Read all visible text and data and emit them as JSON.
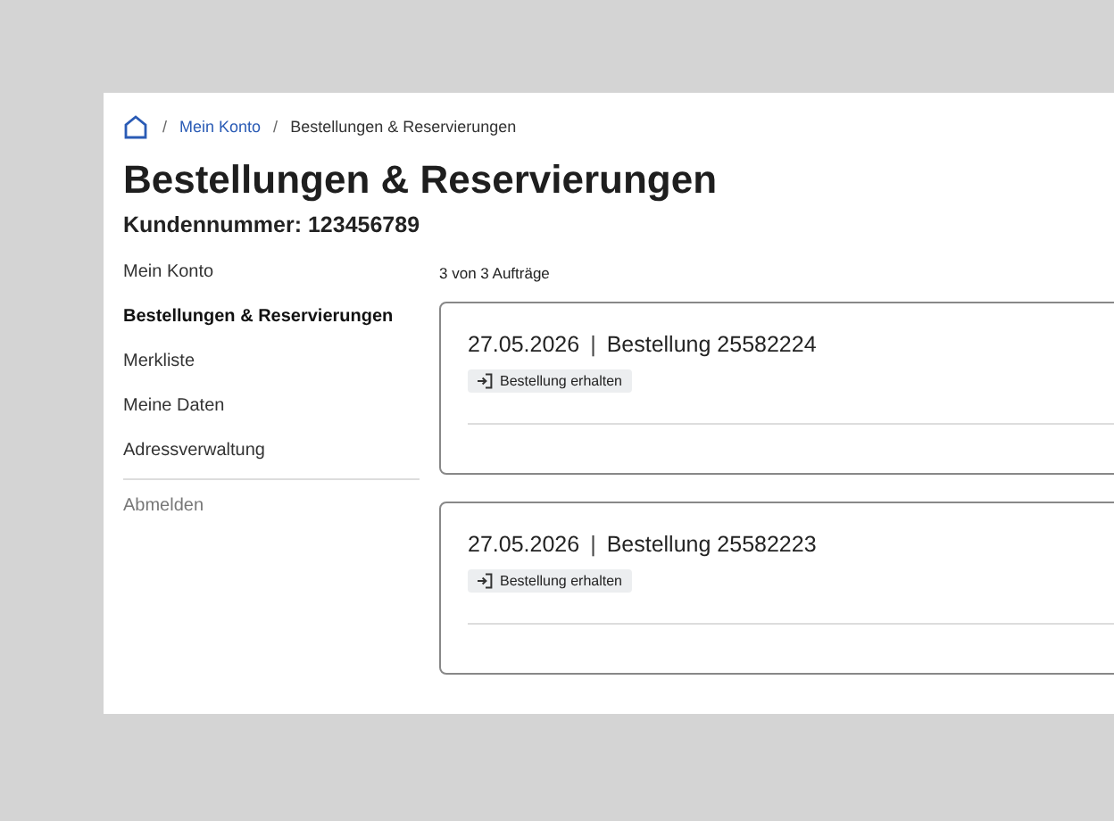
{
  "breadcrumb": {
    "links": [
      "Mein Konto"
    ],
    "separators": [
      "/",
      "/"
    ],
    "current": "Bestellungen & Reservierungen"
  },
  "title": "Bestellungen & Reservierungen",
  "customer_number": "Kundennummer: 123456789",
  "sidebar": {
    "items": [
      {
        "label": "Mein Konto",
        "selected": false
      },
      {
        "label": "Bestellungen & Reservierungen",
        "selected": true
      },
      {
        "label": "Merkliste",
        "selected": false
      },
      {
        "label": "Meine Daten",
        "selected": false
      },
      {
        "label": "Adressverwaltung",
        "selected": false
      }
    ],
    "logout": "Abmelden"
  },
  "count": "3 von 3 Aufträge",
  "orders": [
    {
      "date": "27.05.2026",
      "separator": "|",
      "title": "Bestellung 25582224",
      "status": "Bestellung erhalten"
    },
    {
      "date": "27.05.2026",
      "separator": "|",
      "title": "Bestellung 25582223",
      "status": "Bestellung erhalten"
    }
  ]
}
